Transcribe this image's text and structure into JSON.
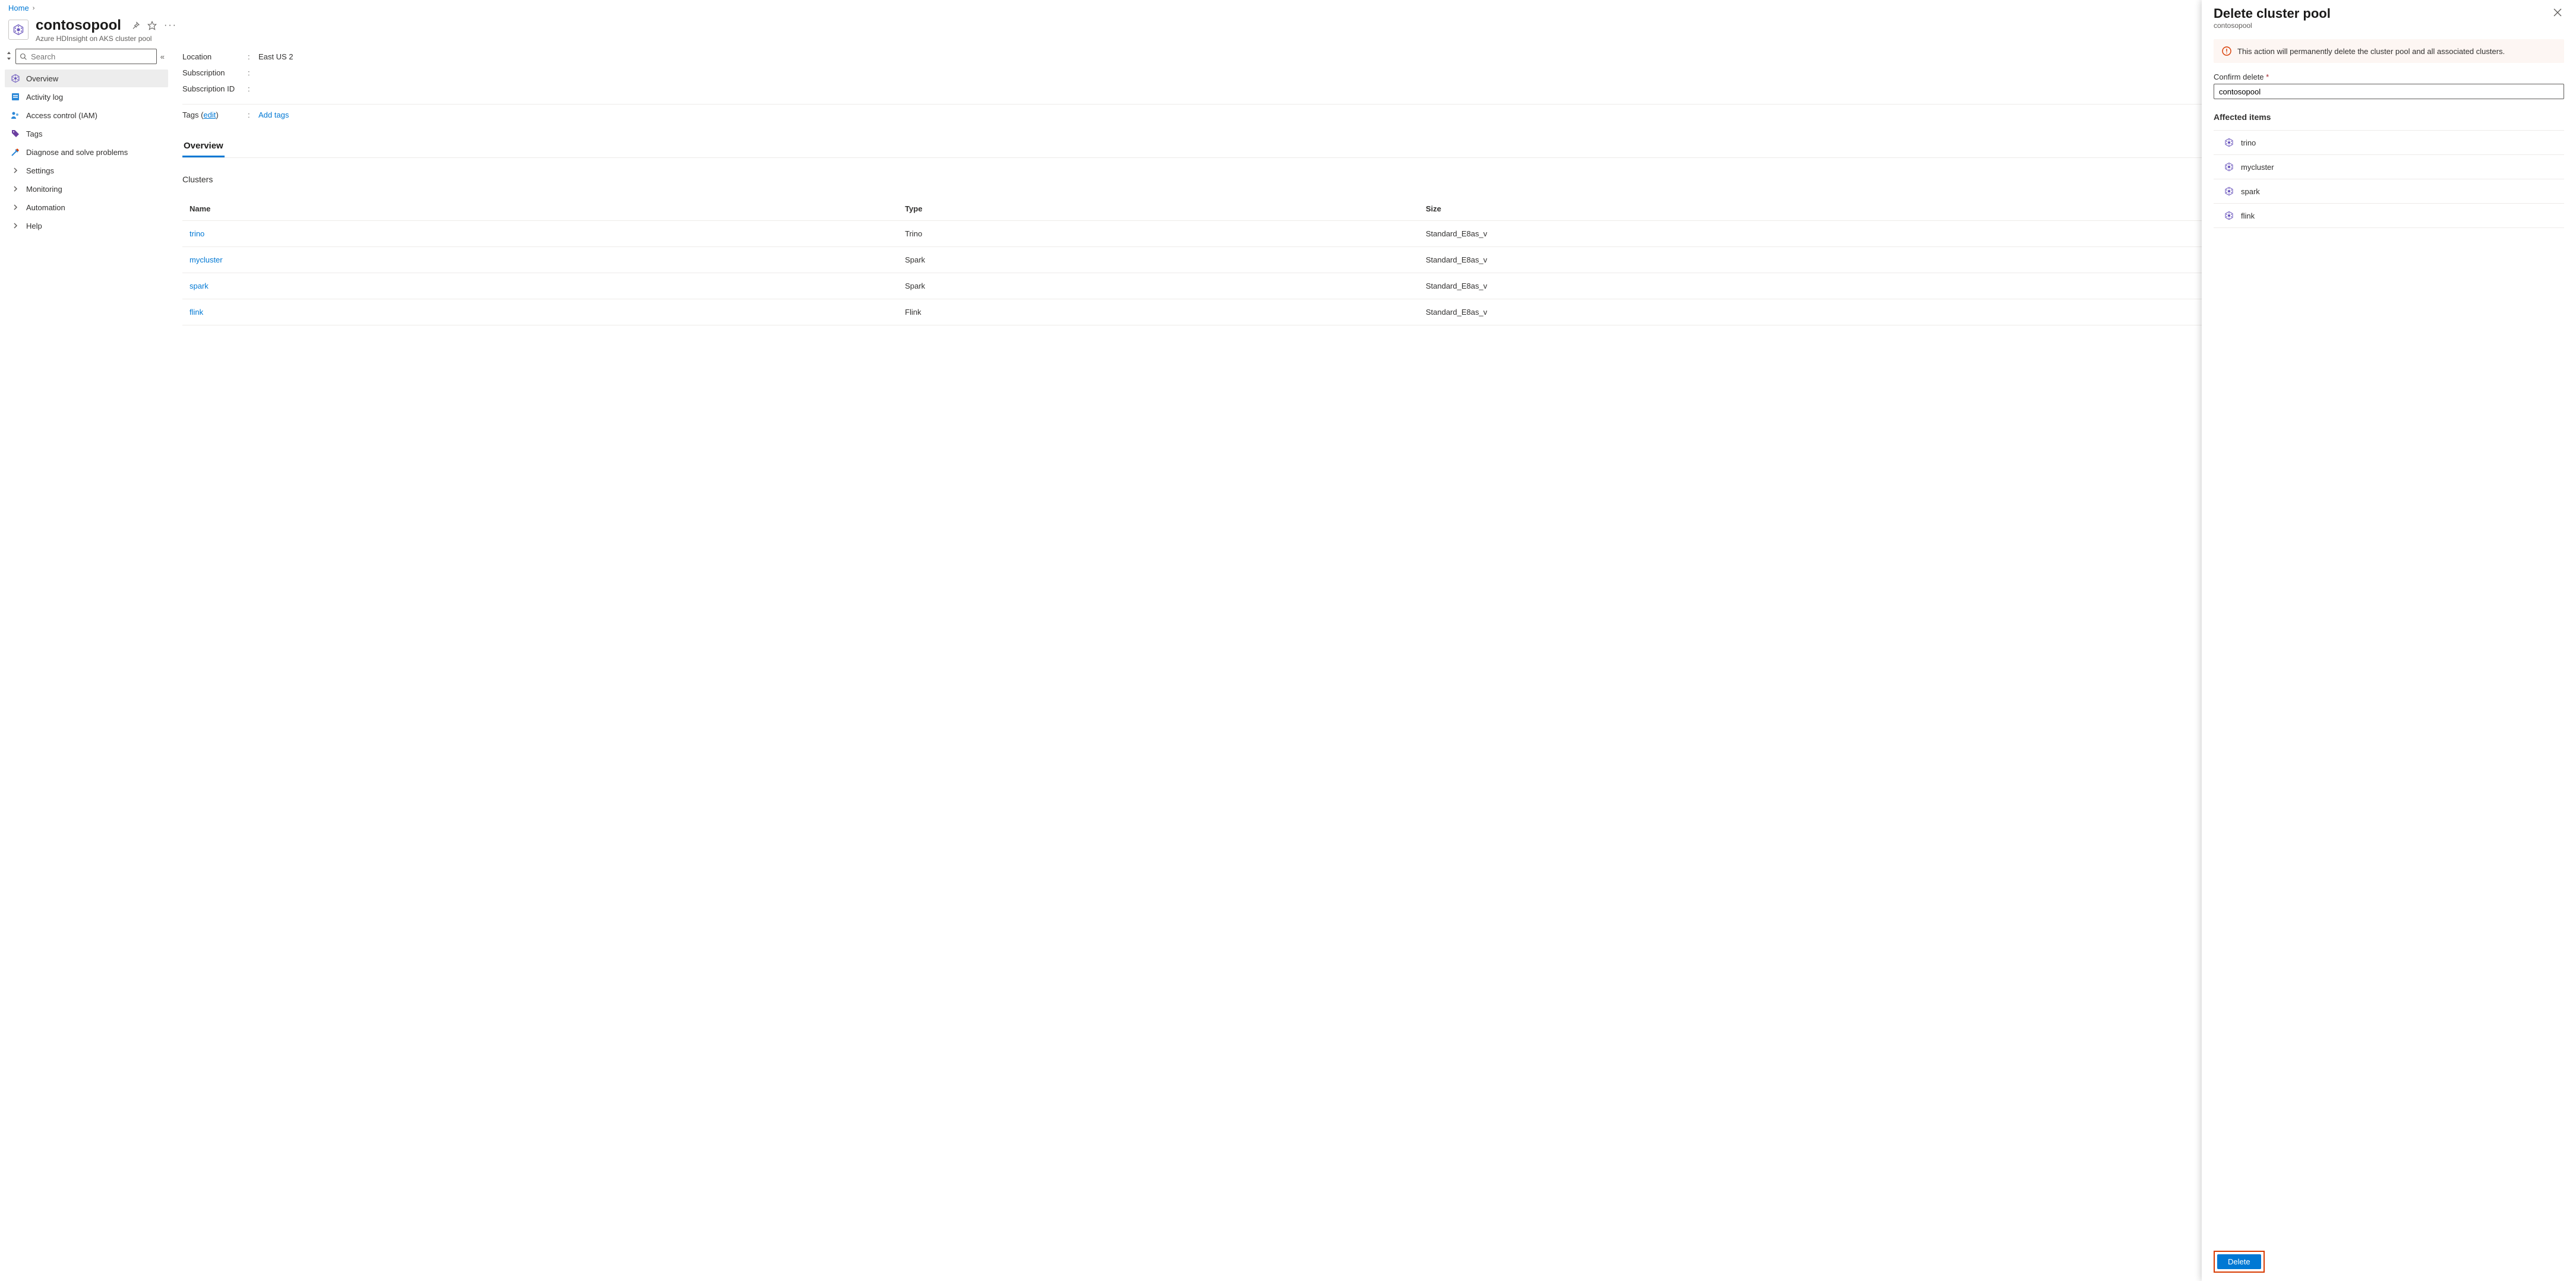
{
  "breadcrumb": {
    "home": "Home"
  },
  "header": {
    "title": "contosopool",
    "subtitle": "Azure HDInsight on AKS cluster pool"
  },
  "sidebar": {
    "search_placeholder": "Search",
    "items": [
      {
        "label": "Overview"
      },
      {
        "label": "Activity log"
      },
      {
        "label": "Access control (IAM)"
      },
      {
        "label": "Tags"
      },
      {
        "label": "Diagnose and solve problems"
      },
      {
        "label": "Settings"
      },
      {
        "label": "Monitoring"
      },
      {
        "label": "Automation"
      },
      {
        "label": "Help"
      }
    ]
  },
  "properties": {
    "location_label": "Location",
    "location_value": "East US 2",
    "subscription_label": "Subscription",
    "subscription_value": "",
    "subscription_id_label": "Subscription ID",
    "subscription_id_value": "",
    "tags_label": "Tags",
    "tags_edit": "edit",
    "tags_add": "Add tags"
  },
  "tabs": {
    "overview": "Overview"
  },
  "clusters": {
    "heading": "Clusters",
    "columns": {
      "name": "Name",
      "type": "Type",
      "size": "Size"
    },
    "rows": [
      {
        "name": "trino",
        "type": "Trino",
        "size": "Standard_E8as_v"
      },
      {
        "name": "mycluster",
        "type": "Spark",
        "size": "Standard_E8as_v"
      },
      {
        "name": "spark",
        "type": "Spark",
        "size": "Standard_E8as_v"
      },
      {
        "name": "flink",
        "type": "Flink",
        "size": "Standard_E8as_v"
      }
    ]
  },
  "flyout": {
    "title": "Delete cluster pool",
    "subtitle": "contosopool",
    "warning": "This action will permanently delete the cluster pool and all associated clusters.",
    "confirm_label": "Confirm delete",
    "confirm_value": "contosopool",
    "affected_label": "Affected items",
    "affected": [
      {
        "name": "trino"
      },
      {
        "name": "mycluster"
      },
      {
        "name": "spark"
      },
      {
        "name": "flink"
      }
    ],
    "delete_button": "Delete"
  }
}
